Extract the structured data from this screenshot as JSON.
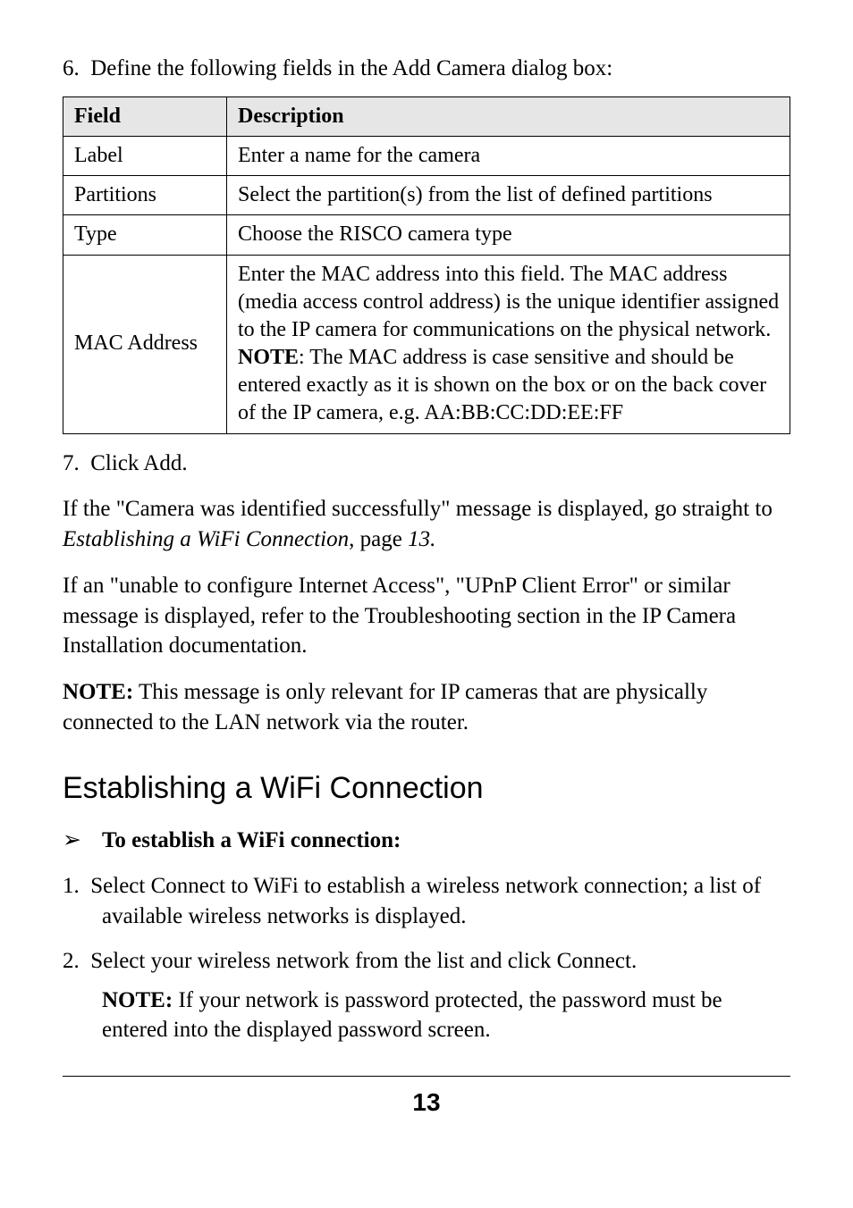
{
  "step6": {
    "num": "6.",
    "text": "Define the following fields in the Add Camera dialog box:"
  },
  "table": {
    "head_field": "Field",
    "head_desc": "Description",
    "rows": [
      {
        "field": "Label",
        "desc": "Enter a name for the camera"
      },
      {
        "field": "Partitions",
        "desc": "Select the partition(s) from the list of defined partitions"
      },
      {
        "field": "Type",
        "desc": "Choose the RISCO camera type"
      }
    ],
    "mac": {
      "field": "MAC Address",
      "desc_pre": "Enter the MAC address into this field. The MAC address (media access control address) is the unique identifier assigned to the IP camera for communications on the physical network.\n",
      "note_label": "NOTE",
      "desc_post": ": The MAC address is case sensitive and should be entered exactly as it is shown on the box or on the back cover of the IP camera, e.g. AA:BB:CC:DD:EE:FF"
    }
  },
  "step7": {
    "num": "7.",
    "text": "Click Add."
  },
  "para_success_pre": "If the \"Camera was identified successfully\" message is displayed, go straight to ",
  "para_success_link": "Establishing a WiFi Connection,",
  "para_success_page_label": " page ",
  "para_success_page_num": "13.",
  "para_unable": "If an \"unable to configure Internet Access\", \"UPnP Client Error\" or similar message is displayed, refer to the Troubleshooting section in the IP Camera Installation documentation.",
  "note_router": {
    "label": "NOTE:",
    "text": " This message is only relevant for IP cameras that are physically connected to the LAN network via the router."
  },
  "heading_wifi": "Establishing a WiFi Connection",
  "bullet_wifi": "To establish a WiFi connection:",
  "wifi_steps": {
    "s1": {
      "num": "1.",
      "text": "Select Connect to WiFi to establish a wireless network connection; a list of available wireless networks is displayed."
    },
    "s2": {
      "num": "2.",
      "text": "Select your wireless network from the list and click Connect.",
      "note_label": "NOTE:",
      "note_text": " If your network is password protected, the password must be entered into the displayed password screen."
    }
  },
  "page_number": "13",
  "chart_data": {
    "type": "table",
    "title": "Add Camera dialog box field definitions",
    "columns": [
      "Field",
      "Description"
    ],
    "rows": [
      [
        "Label",
        "Enter a name for the camera"
      ],
      [
        "Partitions",
        "Select the partition(s) from the list of defined partitions"
      ],
      [
        "Type",
        "Choose the RISCO camera type"
      ],
      [
        "MAC Address",
        "Enter the MAC address into this field. The MAC address (media access control address) is the unique identifier assigned to the IP camera for communications on the physical network. NOTE: The MAC address is case sensitive and should be entered exactly as it is shown on the box or on the back cover of the IP camera, e.g. AA:BB:CC:DD:EE:FF"
      ]
    ]
  }
}
